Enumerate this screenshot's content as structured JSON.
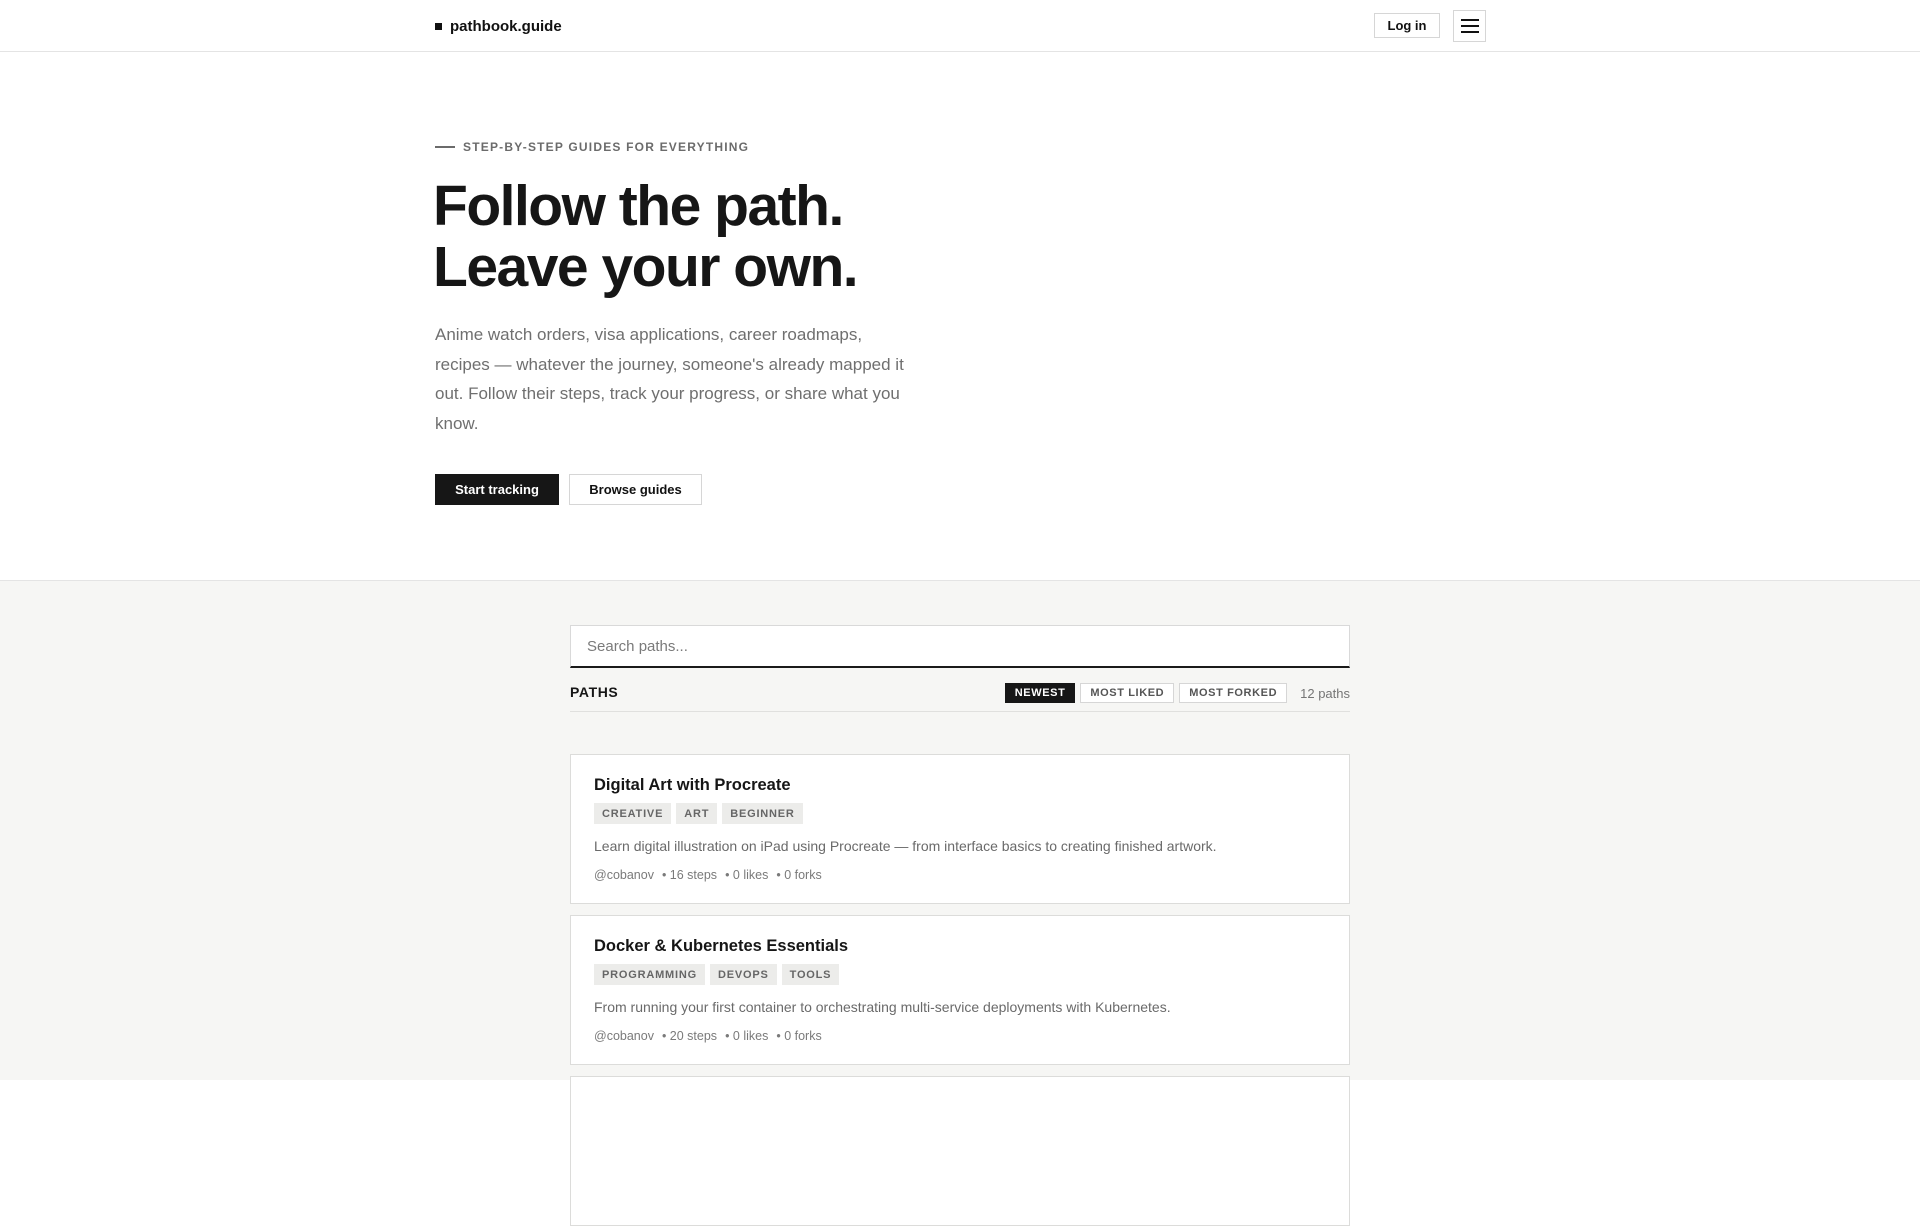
{
  "header": {
    "brand": "pathbook.guide",
    "login_label": "Log in"
  },
  "hero": {
    "eyebrow": "STEP-BY-STEP GUIDES FOR EVERYTHING",
    "headline_line1": "Follow the path.",
    "headline_line2": "Leave your own.",
    "lede": "Anime watch orders, visa applications, career roadmaps, recipes — whatever the journey, someone's already mapped it out. Follow their steps, track your progress, or share what you know.",
    "primary_cta": "Start tracking",
    "secondary_cta": "Browse guides"
  },
  "search": {
    "placeholder": "Search paths..."
  },
  "paths": {
    "title": "PATHS",
    "sort_options": [
      "NEWEST",
      "MOST LIKED",
      "MOST FORKED"
    ],
    "active_sort": "NEWEST",
    "count": "12 paths",
    "items": [
      {
        "title": "Digital Art with Procreate",
        "tags": [
          "CREATIVE",
          "ART",
          "BEGINNER"
        ],
        "description": "Learn digital illustration on iPad using Procreate — from interface basics to creating finished artwork.",
        "author": "@cobanov",
        "steps": "• 16 steps",
        "likes": "• 0 likes",
        "forks": "• 0 forks"
      },
      {
        "title": "Docker & Kubernetes Essentials",
        "tags": [
          "PROGRAMMING",
          "DEVOPS",
          "TOOLS"
        ],
        "description": "From running your first container to orchestrating multi-service deployments with Kubernetes.",
        "author": "@cobanov",
        "steps": "• 20 steps",
        "likes": "• 0 likes",
        "forks": "• 0 forks"
      }
    ]
  }
}
